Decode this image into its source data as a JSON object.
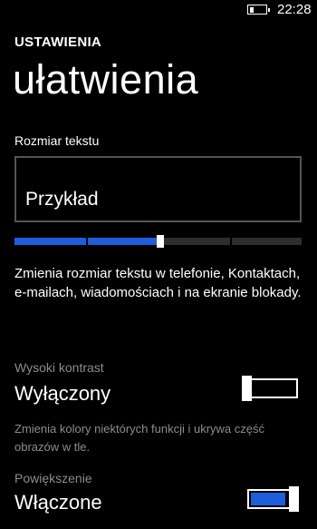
{
  "status_bar": {
    "time": "22:28",
    "battery_level": 0.25
  },
  "header": {
    "app_title": "USTAWIENIA",
    "page_title": "ułatwienia"
  },
  "text_size": {
    "label": "Rozmiar tekstu",
    "preview": "Przykład",
    "slider": {
      "steps": 4,
      "value_fraction": 0.5
    },
    "description": "Zmienia rozmiar tekstu w telefonie, Kontaktach, e-mailach, wiadomościach i na ekranie blokady."
  },
  "high_contrast": {
    "label": "Wysoki kontrast",
    "value": "Wyłączony",
    "on": false,
    "description": "Zmienia kolory niektórych funkcji i ukrywa część obrazów w tle."
  },
  "magnifier": {
    "label": "Powiększenie",
    "value": "Włączone",
    "on": true
  },
  "colors": {
    "accent": "#1d5edc",
    "background": "#000000",
    "text": "#ffffff",
    "subtle_text": "#8c8c8c"
  }
}
